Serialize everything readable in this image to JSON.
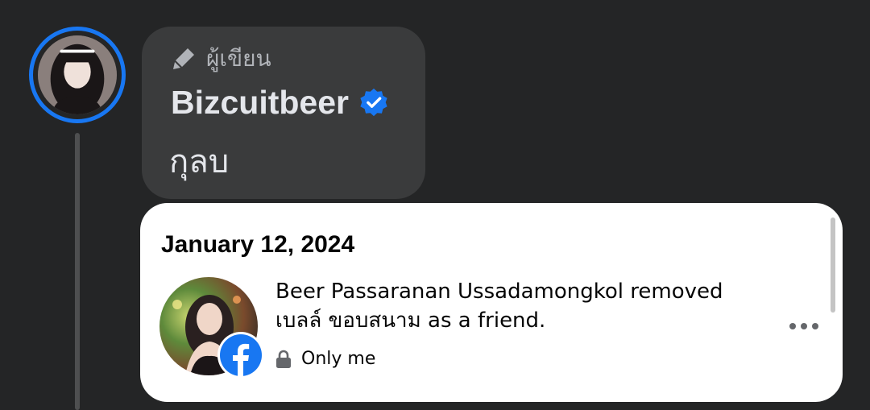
{
  "comment": {
    "role_icon": "pen-icon",
    "role_label": "ผู้เขียน",
    "author_name": "Bizcuitbeer",
    "verified_icon": "verified-badge-icon",
    "text": "กุลบ"
  },
  "activity_card": {
    "date": "January 12, 2024",
    "activity_text": "Beer Passaranan Ussadamongkol removed เบลล์ ขอบสนาม as a friend.",
    "privacy_icon": "lock-icon",
    "privacy_label": "Only me",
    "badge_icon": "facebook-icon",
    "more_icon": "more-horizontal-icon"
  },
  "colors": {
    "background": "#242526",
    "bubble": "#3a3b3c",
    "accent_blue": "#1877f2",
    "card": "#ffffff"
  }
}
